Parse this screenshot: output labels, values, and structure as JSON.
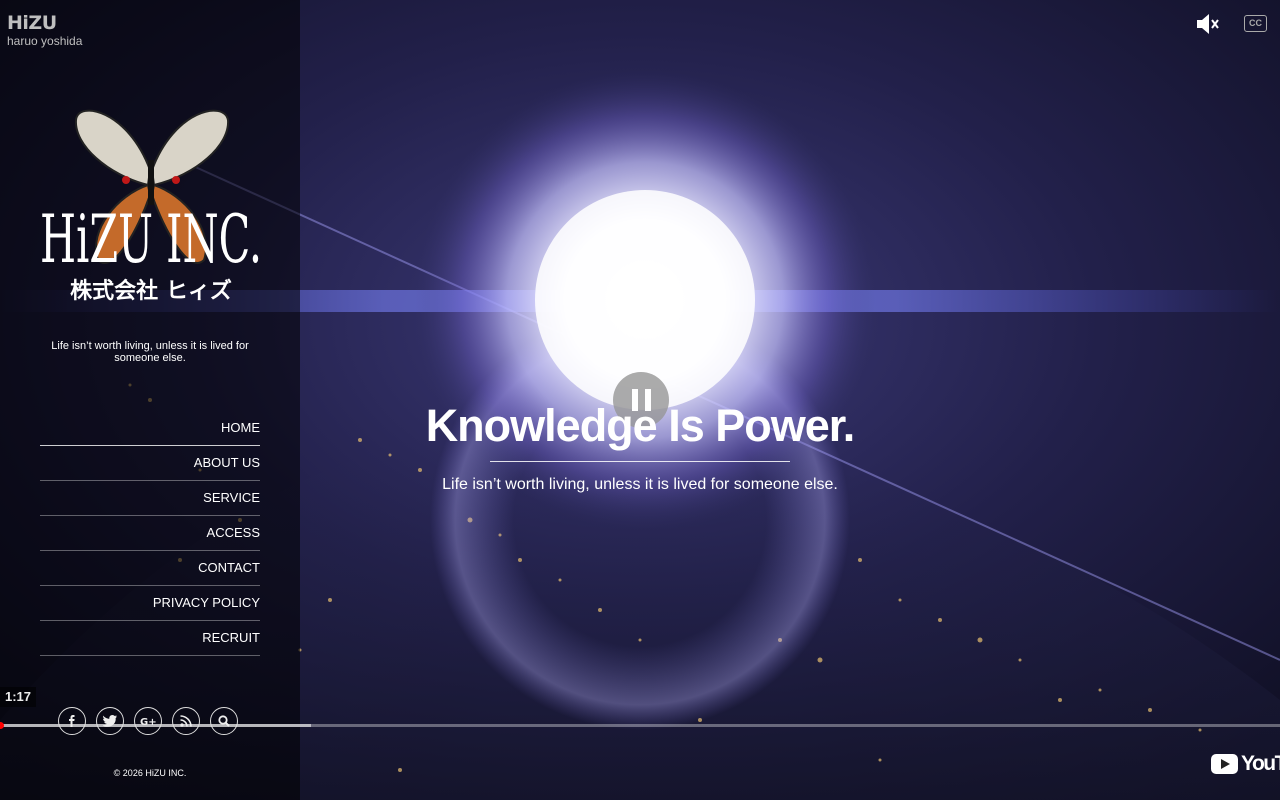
{
  "video": {
    "title": "HiZU",
    "channel": "haruo yoshida",
    "current_time": "1:17",
    "progress_fraction": 0.0,
    "buffered_fraction": 0.243,
    "cc_label": "CC",
    "platform_label": "YouTube"
  },
  "brand": {
    "logo_text": "HiZU INC.",
    "logo_subtext": "株式会社 ヒィズ",
    "tagline": "Life isn’t worth living, unless it is lived for someone else."
  },
  "nav": {
    "items": [
      {
        "label": "HOME"
      },
      {
        "label": "ABOUT US"
      },
      {
        "label": "SERVICE"
      },
      {
        "label": "ACCESS"
      },
      {
        "label": "CONTACT"
      },
      {
        "label": "PRIVACY POLICY"
      },
      {
        "label": "RECRUIT"
      }
    ]
  },
  "socials": [
    "facebook-icon",
    "twitter-icon",
    "google-plus-icon",
    "rss-icon",
    "search-icon"
  ],
  "hero": {
    "title": "Knowledge Is Power.",
    "subtitle": "Life isn’t worth living, unless it is lived for someone else."
  },
  "footer": {
    "copyright": "© 2026 HiZU INC."
  },
  "colors": {
    "accent_progress": "#ff0000",
    "background": "#161630"
  }
}
